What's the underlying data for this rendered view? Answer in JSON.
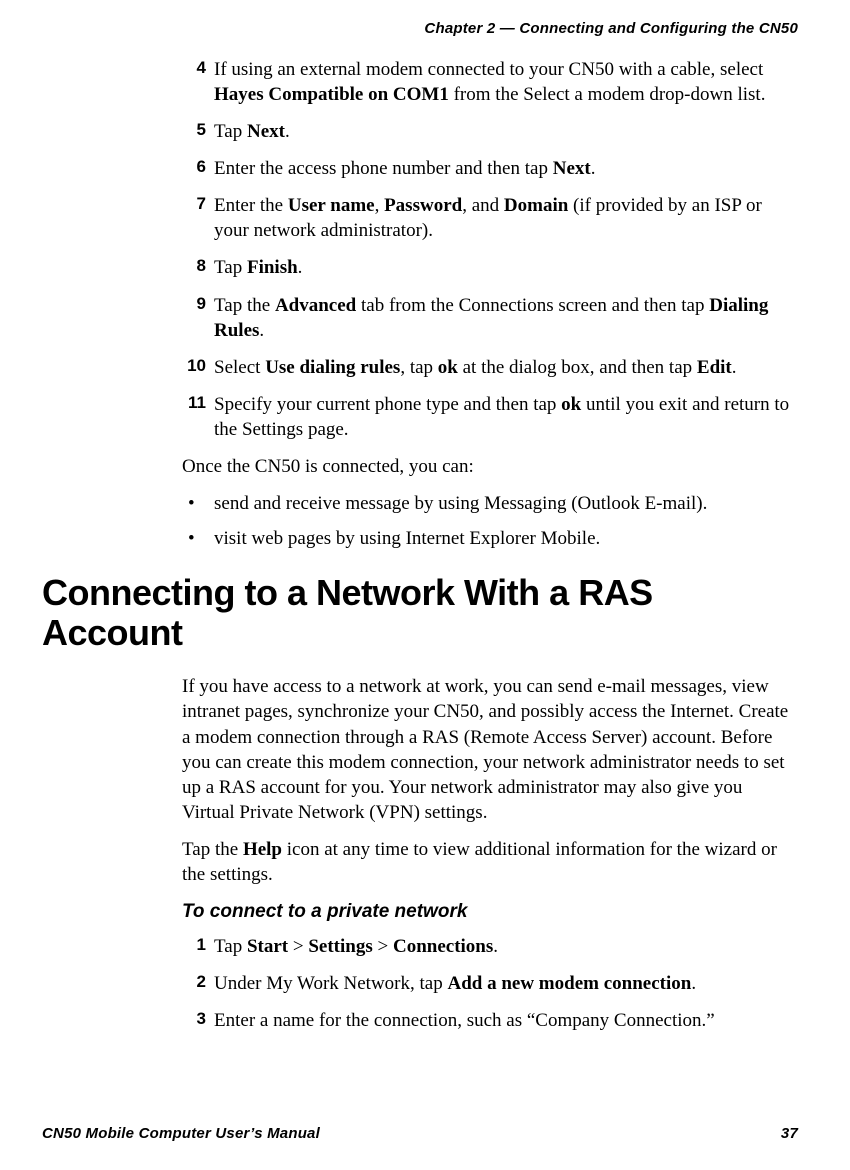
{
  "runningHead": "Chapter 2 — Connecting and Configuring the CN50",
  "steps1": {
    "s4": {
      "n": "4",
      "pre": "If using an external modem connected to your CN50 with a cable, select ",
      "bold": "Hayes Compatible on COM1",
      "post": " from the Select a modem drop-down list."
    },
    "s5": {
      "n": "5",
      "pre": "Tap ",
      "bold": "Next",
      "post": "."
    },
    "s6": {
      "n": "6",
      "pre": "Enter the access phone number and then tap ",
      "bold": "Next",
      "post": "."
    },
    "s7": {
      "n": "7",
      "pre": "Enter the ",
      "b1": "User name",
      "c1": ", ",
      "b2": "Password",
      "c2": ", and ",
      "b3": "Domain",
      "post": " (if provided by an ISP or your network administrator)."
    },
    "s8": {
      "n": "8",
      "pre": "Tap ",
      "bold": "Finish",
      "post": "."
    },
    "s9": {
      "n": "9",
      "pre": "Tap the ",
      "b1": "Advanced",
      "mid": " tab from the Connections screen and then tap ",
      "b2": "Dialing Rules",
      "post": "."
    },
    "s10": {
      "n": "10",
      "pre": "Select ",
      "b1": "Use dialing rules",
      "c1": ", tap ",
      "b2": "ok",
      "c2": " at the dialog box, and then tap ",
      "b3": "Edit",
      "post": "."
    },
    "s11": {
      "n": "11",
      "pre": "Specify your current phone type and then tap ",
      "bold": "ok",
      "post": " until you exit and return to the Settings page."
    }
  },
  "afterStepsPara": "Once the CN50 is connected, you can:",
  "bullets": {
    "b1": "send and receive message by using Messaging (Outlook E-mail).",
    "b2": "visit web pages by using Internet Explorer Mobile."
  },
  "sectionHeading": "Connecting to a Network With a RAS Account",
  "rasIntro": "If you have access to a network at work, you can send e-mail messages, view intranet pages, synchronize your CN50, and possibly access the Internet. Create a modem connection through a RAS (Remote Access Server) account. Before you can create this modem connection, your network administrator needs to set up a RAS account for you. Your network administrator may also give you Virtual Private Network (VPN) settings.",
  "helpPara": {
    "pre": "Tap the ",
    "bold": "Help",
    "post": " icon at any time to view additional information for the wizard or the settings."
  },
  "subHeading": "To connect to a private network",
  "steps2": {
    "s1": {
      "n": "1",
      "pre": "Tap ",
      "b1": "Start",
      "c1": " > ",
      "b2": "Settings",
      "c2": " > ",
      "b3": "Connections",
      "post": "."
    },
    "s2": {
      "n": "2",
      "pre": "Under My Work Network, tap ",
      "bold": "Add a new modem connection",
      "post": "."
    },
    "s3": {
      "n": "3",
      "text": "Enter a name for the connection, such as “Company Connection.”"
    }
  },
  "footer": {
    "left": "CN50 Mobile Computer User’s Manual",
    "right": "37"
  }
}
